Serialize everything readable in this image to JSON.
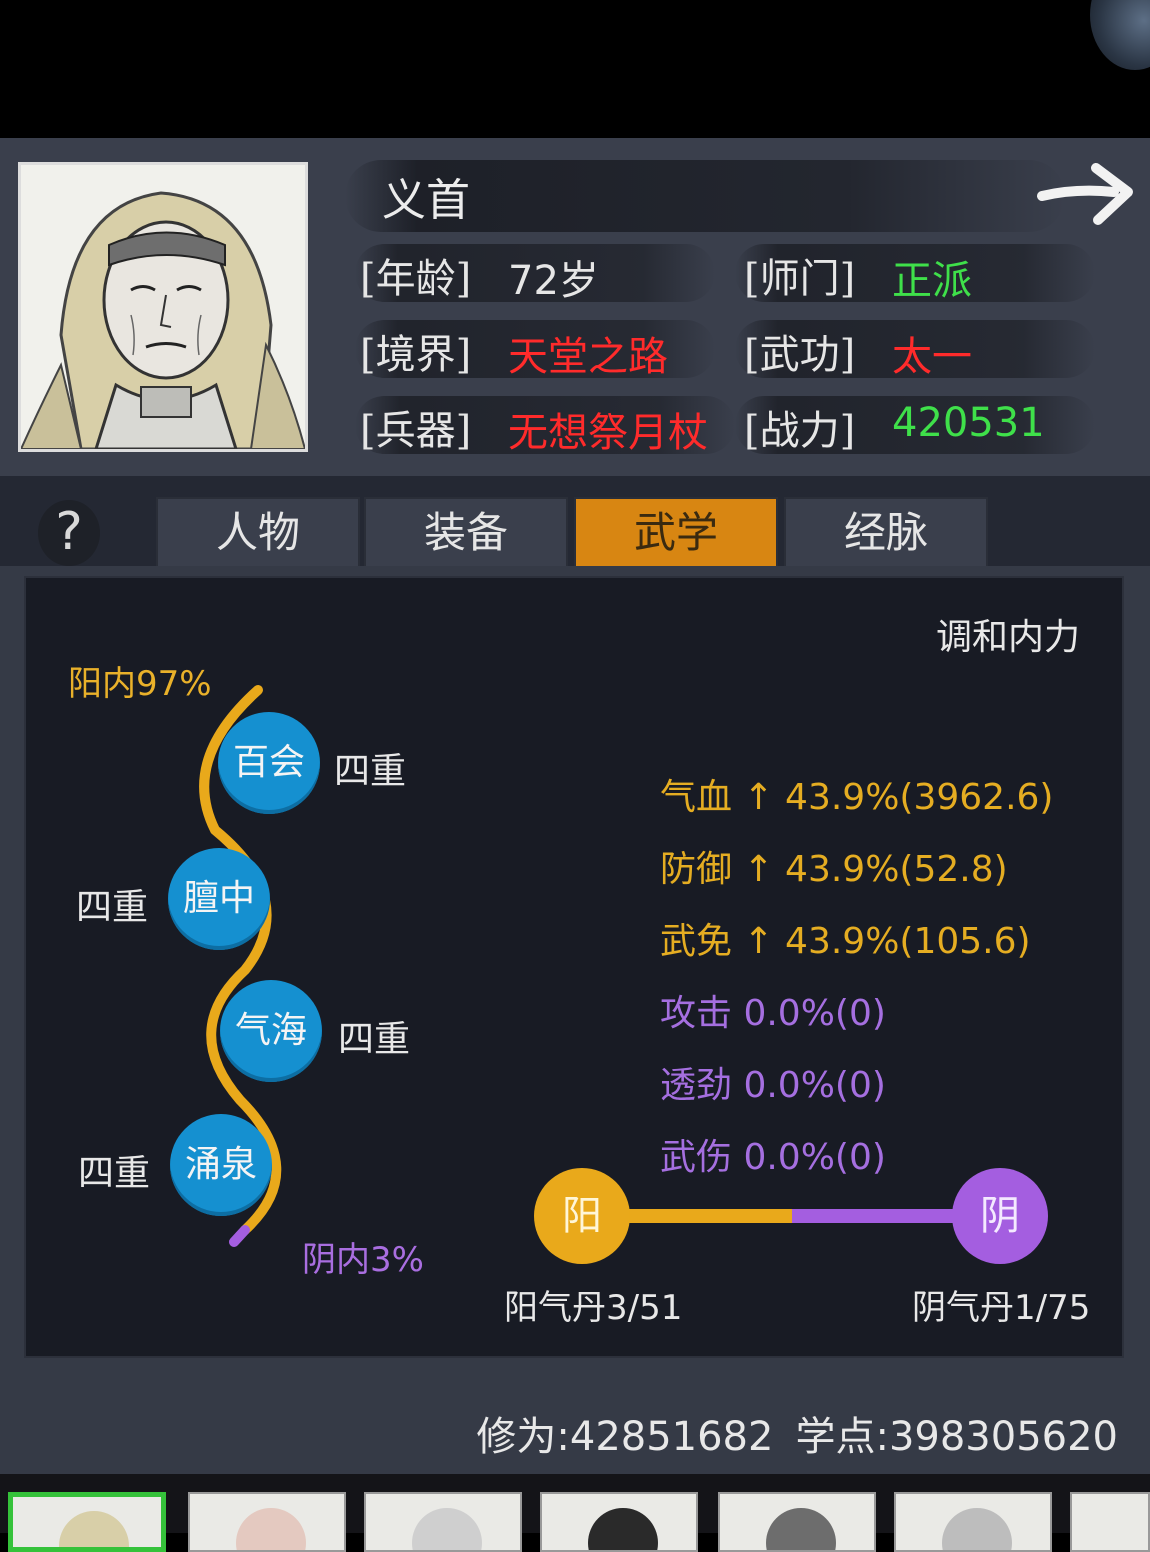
{
  "character": {
    "name": "义首",
    "rows": [
      {
        "label": "[年龄]",
        "value": "72岁",
        "color": "#e6e6e6"
      },
      {
        "label": "[境界]",
        "value": "天堂之路",
        "color": "#ff2b2b"
      },
      {
        "label": "[兵器]",
        "value": "无想祭月杖",
        "color": "#ff2b2b"
      }
    ],
    "rows_right": [
      {
        "label": "[师门]",
        "value": "正派",
        "color": "#3fe04a"
      },
      {
        "label": "[武功]",
        "value": "太一",
        "color": "#ff2b2b"
      },
      {
        "label": "[战力]",
        "value": "420531",
        "color": "#3fe04a"
      }
    ]
  },
  "help_icon": "?",
  "tabs": [
    {
      "label": "人物",
      "active": false
    },
    {
      "label": "装备",
      "active": false
    },
    {
      "label": "武学",
      "active": true
    },
    {
      "label": "经脉",
      "active": false
    }
  ],
  "neili": {
    "harmonize_label": "调和内力",
    "yang_label": "阳内97%",
    "yin_label": "阴内3%",
    "acupoints": [
      {
        "name": "百会",
        "level": "四重"
      },
      {
        "name": "膻中",
        "level": "四重"
      },
      {
        "name": "气海",
        "level": "四重"
      },
      {
        "name": "涌泉",
        "level": "四重"
      }
    ],
    "stats": [
      {
        "text": "气血 ↑ 43.9%(3962.6)",
        "kind": "up"
      },
      {
        "text": "防御 ↑ 43.9%(52.8)",
        "kind": "up"
      },
      {
        "text": "武免 ↑ 43.9%(105.6)",
        "kind": "up"
      },
      {
        "text": "攻击 0.0%(0)",
        "kind": "flat"
      },
      {
        "text": "透劲 0.0%(0)",
        "kind": "flat"
      },
      {
        "text": "武伤 0.0%(0)",
        "kind": "flat"
      }
    ],
    "yang_dan": {
      "icon": "阳",
      "caption": "阳气丹3/51"
    },
    "yin_dan": {
      "icon": "阴",
      "caption": "阴气丹1/75"
    }
  },
  "footer": {
    "cultivation": "修为:42851682",
    "study_points": "学点:398305620"
  },
  "colors": {
    "accent_tab": "#d88612",
    "yang": "#e9a91b",
    "yin": "#a45ee0",
    "acupoint": "#1590d0"
  }
}
